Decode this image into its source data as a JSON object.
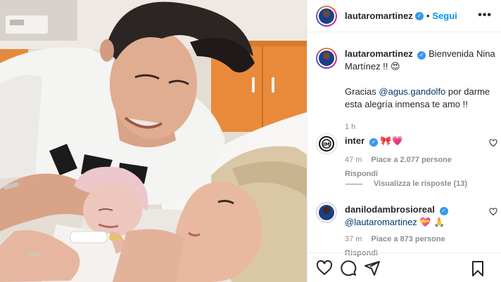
{
  "post": {
    "author": "lautaromartinez",
    "follow_label": "Segui",
    "more_label": "•••"
  },
  "caption": {
    "author": "lautaromartinez",
    "line1": "Bienvenida Nina Martínez !! 😍",
    "thanks_prefix": "Gracias ",
    "thanks_mention": "@agus.gandolfo",
    "thanks_suffix": " por darme esta alegría inmensa te amo !!",
    "time": "1 h"
  },
  "comments": [
    {
      "author": "inter",
      "text": "🎀💗",
      "time": "47 m",
      "likes": "Piace a 2.077 persone",
      "reply": "Rispondi"
    },
    {
      "author": "danilodambrosioreal",
      "mention": "@lautaromartinez",
      "text": " 💝 🙏",
      "time": "37 m",
      "likes": "Piace a 873 persone",
      "reply": "Rispondi"
    }
  ],
  "view_replies": "Visualizza le risposte (13)",
  "icons": [
    "heart-icon",
    "comment-icon",
    "share-icon",
    "bookmark-icon",
    "verified-badge-icon"
  ],
  "colors": {
    "link": "#0095f6",
    "verified": "#3897f0",
    "mention": "#00376b",
    "muted": "#8e8e8e"
  }
}
